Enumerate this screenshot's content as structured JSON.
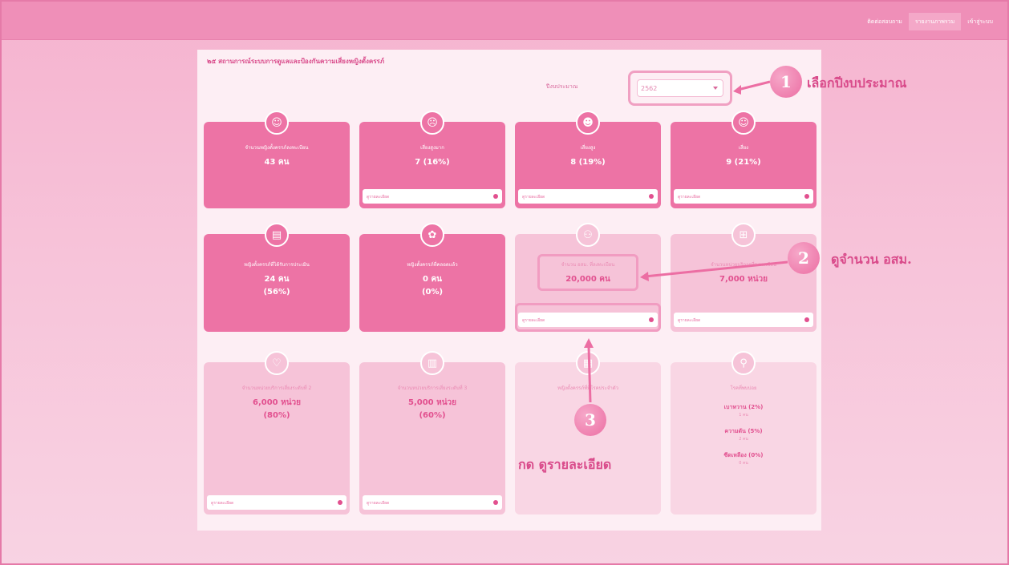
{
  "topnav": [
    "ติดต่อสอบถาม",
    "รายงานภาพรวม",
    "เข้าสู่ระบบ"
  ],
  "panel": {
    "title": "๒๕ สถานการณ์ระบบการดูแลและป้องกันความเสี่ยงหญิงตั้งครรภ์",
    "year_label": "ปีงบประมาณ",
    "year_value": "2562"
  },
  "cards": [
    {
      "label": "จำนวนหญิงตั้งครรภ์ลงทะเบียน",
      "value": "43 คน",
      "pct": "",
      "footer": "",
      "icon": "baby-icon"
    },
    {
      "label": "เสี่ยงสูงมาก",
      "value": "7 (16%)",
      "pct": "",
      "footer": "ดูรายละเอียด",
      "icon": "face-icon"
    },
    {
      "label": "เสี่ยงสูง",
      "value": "8 (19%)",
      "pct": "",
      "footer": "ดูรายละเอียด",
      "icon": "face-icon"
    },
    {
      "label": "เสี่ยง",
      "value": "9 (21%)",
      "pct": "",
      "footer": "ดูรายละเอียด",
      "icon": "smile-icon"
    },
    {
      "label": "หญิงตั้งครรภ์ที่ได้รับการประเมิน",
      "value": "24 คน",
      "pct": "(56%)",
      "footer": "",
      "icon": "document-icon"
    },
    {
      "label": "หญิงตั้งครรภ์ที่คลอดแล้ว",
      "value": "0 คน",
      "pct": "(0%)",
      "footer": "",
      "icon": "mother-icon"
    },
    {
      "label": "จำนวน อสม. ที่ลงทะเบียน",
      "value": "20,000 คน",
      "pct": "",
      "footer": "ดูรายละเอียด",
      "icon": "group-icon"
    },
    {
      "label": "จำนวนหน่วยบริการที่ลงทะเบียน",
      "value": "7,000 หน่วย",
      "pct": "",
      "footer": "ดูรายละเอียด",
      "icon": "hospital-icon"
    },
    {
      "label": "จำนวนหน่วยบริการเสี่ยงระดับที่ 2",
      "value": "6,000 หน่วย",
      "pct": "(80%)",
      "footer": "ดูรายละเอียด",
      "icon": "heart-icon"
    },
    {
      "label": "จำนวนหน่วยบริการเสี่ยงระดับที่ 3",
      "value": "5,000 หน่วย",
      "pct": "(60%)",
      "footer": "ดูรายละเอียด",
      "icon": "building-icon"
    },
    {
      "label": "หญิงตั้งครรภ์ที่มีโรคประจำตัว",
      "value": "",
      "pct": "",
      "footer": "",
      "icon": "clipboard-icon"
    },
    {
      "label": "โรคที่พบบ่อย",
      "value": "",
      "pct": "",
      "footer": "",
      "icon": "search-icon",
      "diseases": [
        {
          "name": "เบาหวาน (2%)",
          "count": "1 คน"
        },
        {
          "name": "ความดัน (5%)",
          "count": "2 คน"
        },
        {
          "name": "ซีดเหลือง (0%)",
          "count": "0 คน"
        }
      ]
    }
  ],
  "annotations": {
    "one": "1",
    "one_text": "เลือกปีงบประมาณ",
    "two": "2",
    "two_text": "ดูจำนวน อสม.",
    "three": "3",
    "three_text": "กด ดูรายละเอียด"
  },
  "colors": {
    "accent": "#ed73a5",
    "light": "#f6c3d8",
    "pale": "#f9d6e4",
    "annotation": "#d94a8a"
  }
}
